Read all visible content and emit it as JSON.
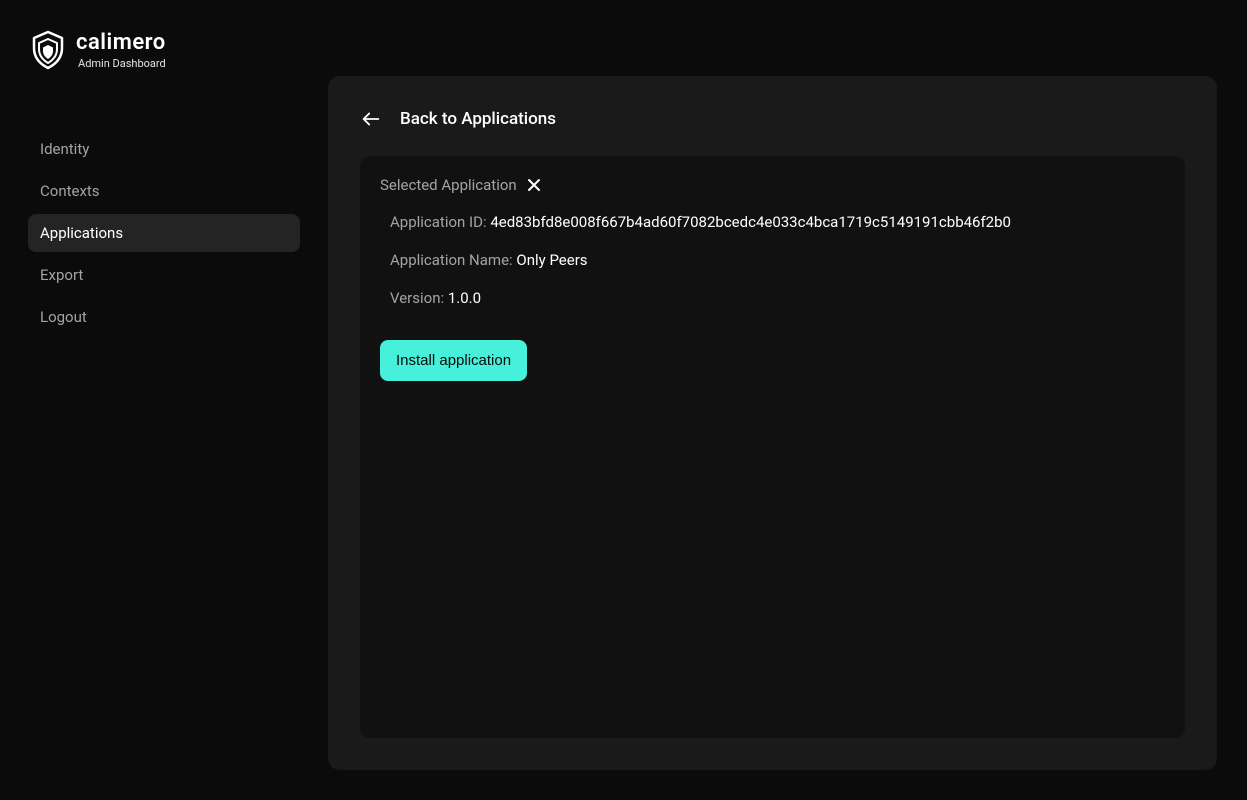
{
  "brand": {
    "name": "calimero",
    "subtitle": "Admin Dashboard"
  },
  "sidebar": {
    "items": [
      {
        "label": "Identity",
        "active": false
      },
      {
        "label": "Contexts",
        "active": false
      },
      {
        "label": "Applications",
        "active": true
      },
      {
        "label": "Export",
        "active": false
      },
      {
        "label": "Logout",
        "active": false
      }
    ]
  },
  "header": {
    "back_label": "Back to Applications"
  },
  "app_card": {
    "title": "Selected Application",
    "fields": {
      "id_label": "Application ID: ",
      "id_value": "4ed83bfd8e008f667b4ad60f7082bcedc4e033c4bca1719c5149191cbb46f2b0",
      "name_label": "Application Name: ",
      "name_value": "Only Peers",
      "ver_label": "Version: ",
      "ver_value": "1.0.0"
    },
    "install_label": "Install application"
  },
  "colors": {
    "accent": "#46f0db",
    "bg": "#0b0b0b",
    "panel": "#1a1a1a",
    "panel_inner": "#111111"
  }
}
